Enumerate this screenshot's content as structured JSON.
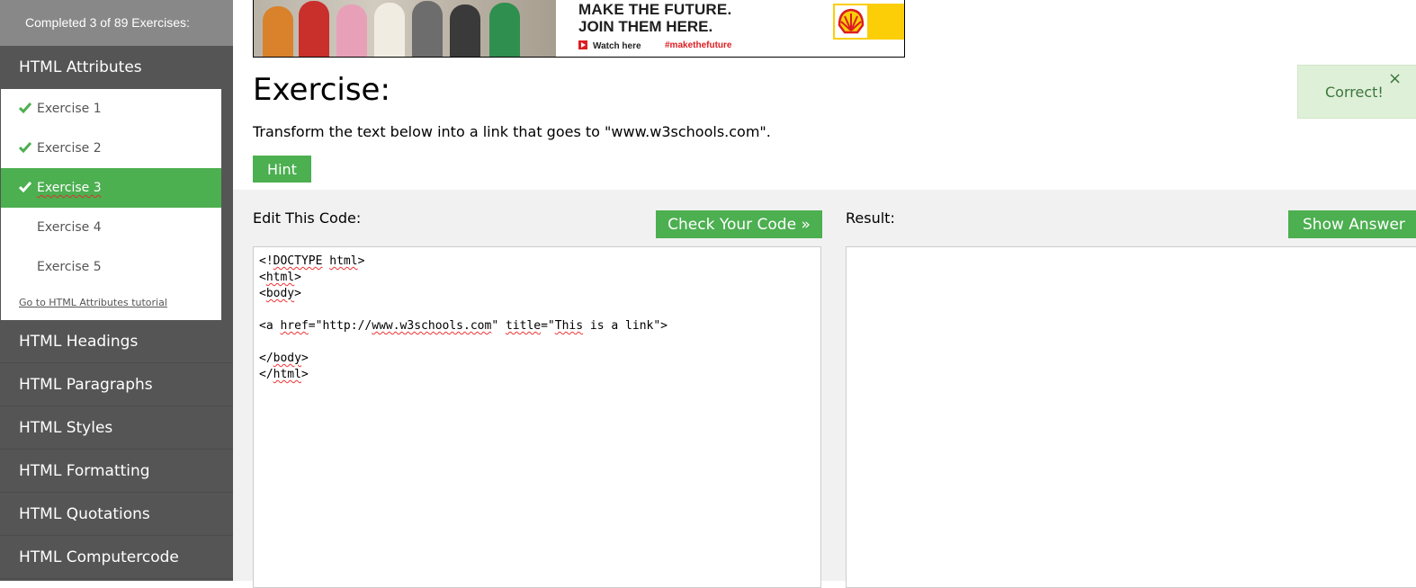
{
  "sidebar": {
    "progress": "Completed 3 of 89 Exercises:",
    "current_section": "HTML Attributes",
    "exercises": [
      {
        "label": "Exercise 1",
        "completed": true,
        "active": false
      },
      {
        "label": "Exercise 2",
        "completed": true,
        "active": false
      },
      {
        "label": "Exercise 3",
        "completed": true,
        "active": true
      },
      {
        "label": "Exercise 4",
        "completed": false,
        "active": false
      },
      {
        "label": "Exercise 5",
        "completed": false,
        "active": false
      }
    ],
    "tutorial_link": "Go to HTML Attributes tutorial",
    "sections": [
      "HTML Headings",
      "HTML Paragraphs",
      "HTML Styles",
      "HTML Formatting",
      "HTML Quotations",
      "HTML Computercode"
    ]
  },
  "ad": {
    "line1": "MAKE THE FUTURE.",
    "line2": "JOIN THEM HERE.",
    "watch": "Watch here",
    "hashtag": "#makethefuture",
    "logo": "shell-logo"
  },
  "exercise": {
    "title": "Exercise:",
    "description": "Transform the text below into a link that goes to \"www.w3schools.com\".",
    "hint_label": "Hint"
  },
  "notification": {
    "text": "Correct!",
    "close": "×"
  },
  "editor": {
    "label": "Edit This Code:",
    "check_button": "Check Your Code »",
    "code_lines": [
      "<!DOCTYPE html>",
      "<html>",
      "<body>",
      "",
      "<a href=\"http://www.w3schools.com\" title=\"This is a link\">",
      "",
      "</body>",
      "</html>"
    ]
  },
  "result": {
    "label": "Result:",
    "answer_button": "Show Answer"
  },
  "colors": {
    "accent": "#4caf50",
    "sidebar_bg": "#555555",
    "progress_bg": "#888888",
    "success_bg": "#dff0d8",
    "success_text": "#3c763d",
    "editor_area_bg": "#f1f1f1"
  }
}
